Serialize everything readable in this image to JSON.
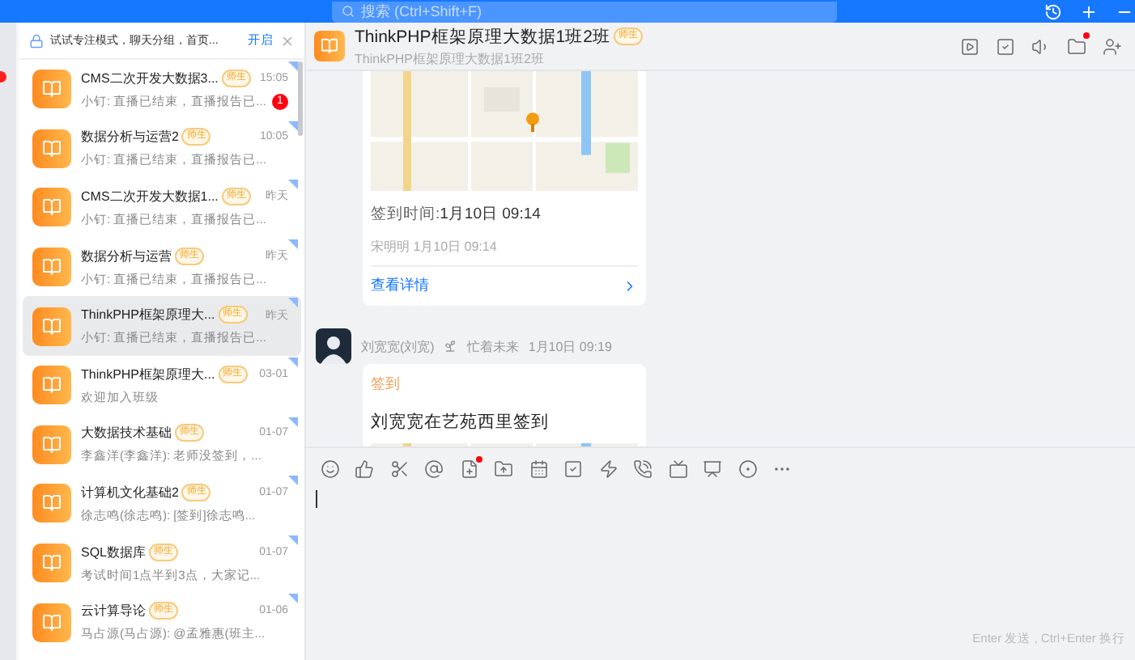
{
  "top_bar": {
    "search": {
      "placeholder": "搜索 (Ctrl+Shift+F)"
    },
    "buttons": [
      {
        "kind": "history"
      },
      {
        "kind": "add"
      },
      {
        "kind": "minimize"
      }
    ]
  },
  "side_strip": {
    "unread": true
  },
  "notice": {
    "text": "试试专注模式，聊天分组，首页...",
    "action": "开启"
  },
  "conversations": [
    {
      "name": "CMS二次开发大数据3...",
      "tag": "师生",
      "time": "15:05",
      "preview": "小钉: 直播已结束，直播报告已...",
      "unread": "1",
      "selected": false
    },
    {
      "name": "数据分析与运营2",
      "tag": "师生",
      "time": "10:05",
      "preview": "小钉: 直播已结束，直播报告已...",
      "selected": false
    },
    {
      "name": "CMS二次开发大数据1...",
      "tag": "师生",
      "time": "昨天",
      "preview": "小钉: 直播已结束，直播报告已...",
      "selected": false
    },
    {
      "name": "数据分析与运营",
      "tag": "师生",
      "time": "昨天",
      "preview": "小钉: 直播已结束，直播报告已...",
      "selected": false
    },
    {
      "name": "ThinkPHP框架原理大...",
      "tag": "师生",
      "time": "昨天",
      "preview": "小钉: 直播已结束，直播报告已...",
      "selected": true
    },
    {
      "name": "ThinkPHP框架原理大...",
      "tag": "师生",
      "time": "03-01",
      "preview": "欢迎加入班级",
      "selected": false
    },
    {
      "name": "大数据技术基础",
      "tag": "师生",
      "time": "01-07",
      "preview": "李鑫洋(李鑫洋): 老师没签到，...",
      "selected": false
    },
    {
      "name": "计算机文化基础2",
      "tag": "师生",
      "time": "01-07",
      "preview": "徐志鸣(徐志鸣): [签到]徐志鸣...",
      "selected": false
    },
    {
      "name": "SQL数据库",
      "tag": "师生",
      "time": "01-07",
      "preview": "考试时间1点半到3点，大家记...",
      "selected": false
    },
    {
      "name": "云计算导论",
      "tag": "师生",
      "time": "01-06",
      "preview": "马占源(马占源): @孟雅惠(班主...",
      "selected": false
    }
  ],
  "chat": {
    "title": "ThinkPHP框架原理大数据1班2班",
    "tag": "师生",
    "subtitle": "ThinkPHP框架原理大数据1班2班",
    "header_buttons": [
      {
        "kind": "video",
        "badge": false
      },
      {
        "kind": "task",
        "badge": false
      },
      {
        "kind": "speaker",
        "badge": false
      },
      {
        "kind": "folder",
        "badge": true
      },
      {
        "kind": "add-member",
        "badge": false
      }
    ],
    "messages": [
      {
        "kind": "checkin-detail",
        "time_label": "签到时间:",
        "time_value": "1月10日 09:14",
        "signer": "宋明明 1月10日 09:14",
        "link": "查看详情"
      },
      {
        "kind": "checkin",
        "sender": "刘宽宽(刘宽)",
        "status": "忙着未来",
        "time": "1月10日 09:19",
        "label": "签到",
        "text": "刘宽宽在艺苑西里签到"
      }
    ],
    "toolbar": [
      {
        "kind": "emoji",
        "badge": false
      },
      {
        "kind": "like",
        "badge": false
      },
      {
        "kind": "cut",
        "badge": false
      },
      {
        "kind": "mention",
        "badge": false
      },
      {
        "kind": "doc",
        "badge": true
      },
      {
        "kind": "upload",
        "badge": false
      },
      {
        "kind": "calendar",
        "badge": false
      },
      {
        "kind": "task",
        "badge": false
      },
      {
        "kind": "flash",
        "badge": false
      },
      {
        "kind": "call",
        "badge": false
      },
      {
        "kind": "live",
        "badge": false
      },
      {
        "kind": "present",
        "badge": false
      },
      {
        "kind": "record",
        "badge": false
      },
      {
        "kind": "more",
        "badge": false
      }
    ],
    "hint": "Enter 发送 , Ctrl+Enter 换行"
  }
}
